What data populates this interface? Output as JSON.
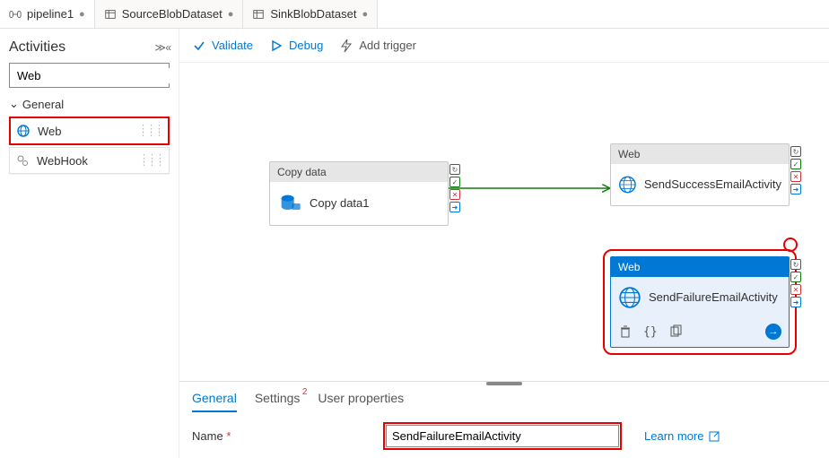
{
  "tabs": {
    "pipeline": "pipeline1",
    "source_ds": "SourceBlobDataset",
    "sink_ds": "SinkBlobDataset"
  },
  "sidebar": {
    "title": "Activities",
    "search_value": "Web",
    "group": "General",
    "items": [
      {
        "label": "Web",
        "icon": "globe-icon"
      },
      {
        "label": "WebHook",
        "icon": "gears-icon"
      }
    ]
  },
  "toolbar": {
    "validate": "Validate",
    "debug": "Debug",
    "add_trigger": "Add trigger"
  },
  "nodes": {
    "copy": {
      "header": "Copy data",
      "title": "Copy data1"
    },
    "success": {
      "header": "Web",
      "title": "SendSuccessEmailActivity"
    },
    "failure": {
      "header": "Web",
      "title": "SendFailureEmailActivity"
    }
  },
  "status_legend": [
    "sync",
    "ok",
    "err",
    "all"
  ],
  "props": {
    "tabs": {
      "general": "General",
      "settings": "Settings",
      "settings_badge": "2",
      "user_props": "User properties"
    },
    "name_label": "Name",
    "name_value": "SendFailureEmailActivity",
    "learn_more": "Learn more"
  }
}
